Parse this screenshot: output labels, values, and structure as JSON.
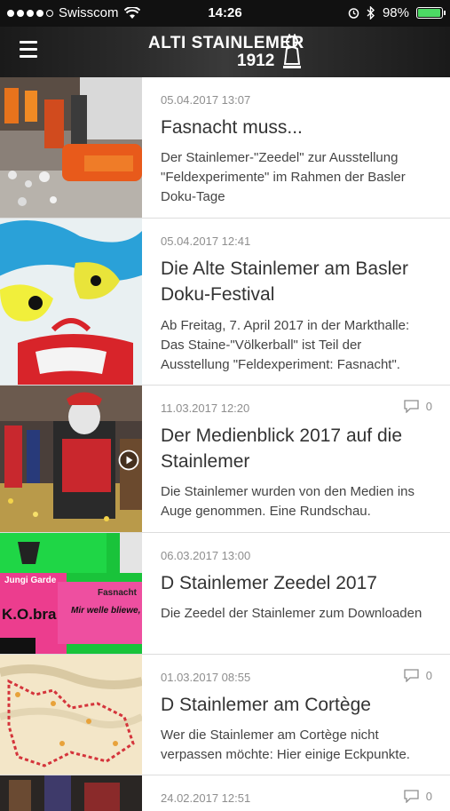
{
  "status": {
    "carrier": "Swisscom",
    "time": "14:26",
    "battery": "98%",
    "battery_level": 0.98
  },
  "header": {
    "logo_line1": "ALTI STAINLEMER",
    "logo_line2": "1912"
  },
  "items": [
    {
      "date": "05.04.2017 13:07",
      "title": "Fasnacht muss...",
      "excerpt": "Der Stainlemer-\"Zeedel\" zur Ausstellung \"Feldexperimente\" im Rahmen der Basler Doku-Tage"
    },
    {
      "date": "05.04.2017 12:41",
      "title": "Die Alte Stainlemer am Basler Doku-Festival",
      "excerpt": "Ab Freitag, 7. April 2017 in der Markthalle: Das Staine-\"Völkerball\" ist Teil der Ausstellung \"Feldexperiment: Fasnacht\"."
    },
    {
      "date": "11.03.2017 12:20",
      "comments": "0",
      "title": "Der Medienblick 2017 auf die Stainlemer",
      "excerpt": "Die Stainlemer wurden von den Medien ins Auge genommen. Eine Rundschau."
    },
    {
      "date": "06.03.2017 13:00",
      "title": "D Stainlemer Zeedel 2017",
      "excerpt": "Die Zeedel der Stainlemer zum Downloaden",
      "thumb_text": [
        "Jungi Garde",
        "Fasnacht",
        "K.O.bra",
        "Mir welle bliewe,"
      ]
    },
    {
      "date": "01.03.2017 08:55",
      "comments": "0",
      "title": "D Stainlemer am Cortège",
      "excerpt": "Wer die Stainlemer am Cortège nicht verpassen möchte: Hier einige Eckpunkte."
    },
    {
      "date": "24.02.2017 12:51",
      "comments": "0"
    }
  ]
}
